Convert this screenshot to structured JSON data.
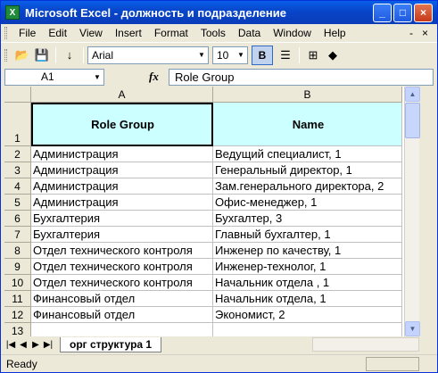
{
  "window": {
    "title": "Microsoft Excel - должность и подразделение",
    "app_icon": "X"
  },
  "menu": {
    "items": [
      "File",
      "Edit",
      "View",
      "Insert",
      "Format",
      "Tools",
      "Data",
      "Window",
      "Help"
    ],
    "right_controls": [
      "-",
      "×"
    ]
  },
  "toolbar": {
    "font_name": "Arial",
    "font_size": "10",
    "bold_label": "B"
  },
  "formula_bar": {
    "name_box": "A1",
    "fx_label": "fx",
    "value": "Role Group"
  },
  "sheet": {
    "col_headers": [
      "A",
      "B"
    ],
    "header_row": {
      "row": "1",
      "a": "Role Group",
      "b": "Name"
    },
    "rows": [
      {
        "row": "2",
        "a": "Администрация",
        "b": "Ведущий специалист, 1"
      },
      {
        "row": "3",
        "a": "Администрация",
        "b": "Генеральный директор, 1"
      },
      {
        "row": "4",
        "a": "Администрация",
        "b": "Зам.генерального директора, 2"
      },
      {
        "row": "5",
        "a": "Администрация",
        "b": "Офис-менеджер, 1"
      },
      {
        "row": "6",
        "a": "Бухгалтерия",
        "b": "Бухгалтер, 3"
      },
      {
        "row": "7",
        "a": "Бухгалтерия",
        "b": "Главный бухгалтер, 1"
      },
      {
        "row": "8",
        "a": "Отдел технического контроля",
        "b": "Инженер по качеству, 1"
      },
      {
        "row": "9",
        "a": "Отдел технического контроля",
        "b": "Инженер-технолог, 1"
      },
      {
        "row": "10",
        "a": "Отдел технического контроля",
        "b": "Начальник отдела , 1"
      },
      {
        "row": "11",
        "a": "Финансовый отдел",
        "b": "Начальник отдела, 1"
      },
      {
        "row": "12",
        "a": "Финансовый отдел",
        "b": "Экономист, 2"
      },
      {
        "row": "13",
        "a": "",
        "b": ""
      }
    ]
  },
  "tabs": {
    "sheet_name": "орг структура 1"
  },
  "status": {
    "text": "Ready"
  },
  "colors": {
    "header_fill": "#ccffff",
    "titlebar": "#0a5ee8"
  }
}
